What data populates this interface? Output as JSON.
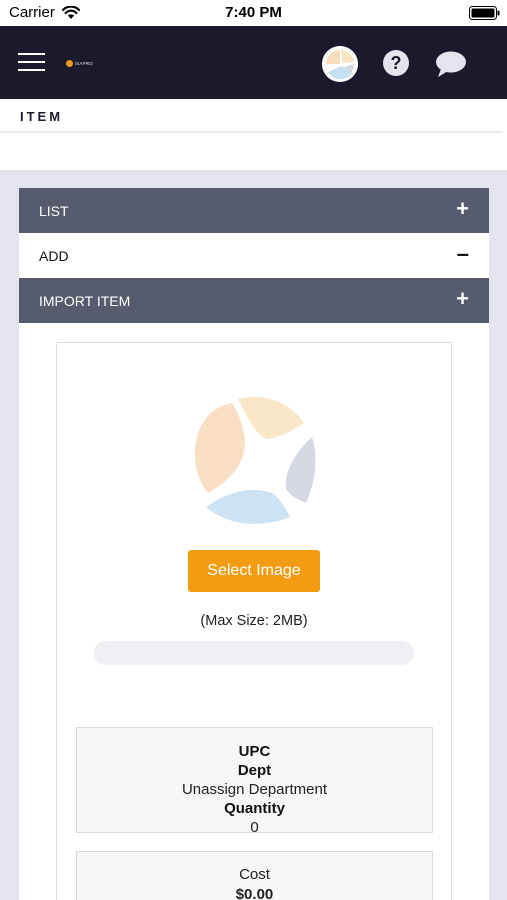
{
  "status_bar": {
    "carrier": "Carrier",
    "time": "7:40 PM"
  },
  "header": {
    "logo_text": "iSAPRO",
    "icons": [
      "menu-icon",
      "avatar",
      "help-icon",
      "chat-icon"
    ],
    "background_color": "#1b1a2c"
  },
  "page": {
    "title": "ITEM"
  },
  "accordion": [
    {
      "label": "LIST",
      "toggle": "+",
      "expanded": false
    },
    {
      "label": "ADD",
      "toggle": "–",
      "expanded": true
    },
    {
      "label": "IMPORT ITEM",
      "toggle": "+",
      "expanded": false
    }
  ],
  "upload": {
    "button_label": "Select Image",
    "max_size_text": "(Max Size: 2MB)",
    "progress_percent": 0,
    "button_color": "#f39c12"
  },
  "item_info": {
    "upc_label": "UPC",
    "dept_label": "Dept",
    "dept_value": "Unassign Department",
    "quantity_label": "Quantity",
    "quantity_value": "0",
    "cost_label": "Cost",
    "cost_value": "$0.00"
  }
}
